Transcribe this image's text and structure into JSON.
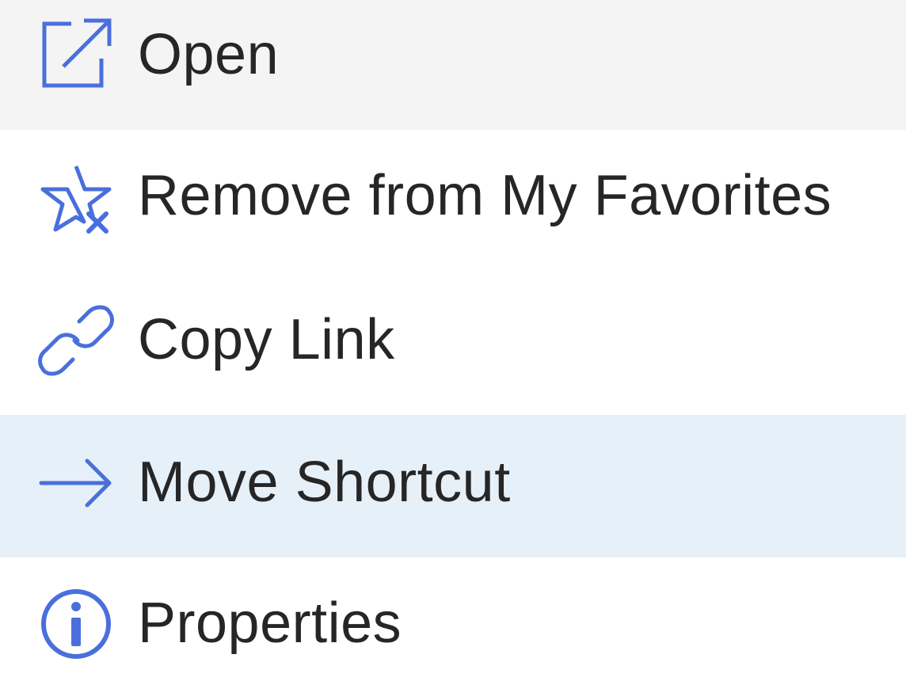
{
  "menu": {
    "accent_color": "#4a6fdc",
    "hover_bg": "#e6f0f8",
    "active_bg": "#f4f4f4",
    "items": [
      {
        "label": "Open",
        "icon": "open-external-icon"
      },
      {
        "label": "Remove from My Favorites",
        "icon": "star-remove-icon"
      },
      {
        "label": "Copy Link",
        "icon": "link-icon"
      },
      {
        "label": "Move Shortcut",
        "icon": "arrow-right-icon"
      },
      {
        "label": "Properties",
        "icon": "info-icon"
      }
    ]
  }
}
